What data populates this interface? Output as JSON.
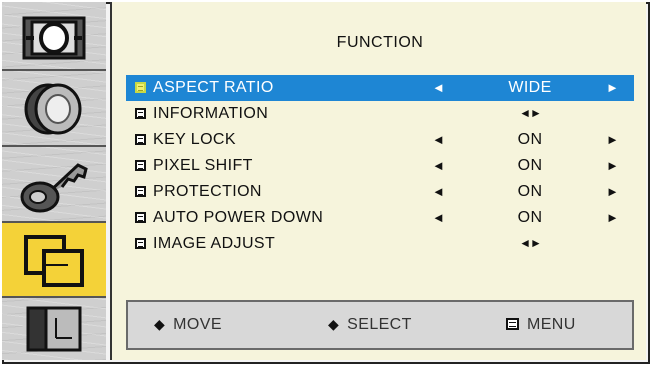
{
  "sidebar": {
    "items": [
      {
        "icon": "picture-icon",
        "active": false
      },
      {
        "icon": "sound-icon",
        "active": false
      },
      {
        "icon": "key-icon",
        "active": false
      },
      {
        "icon": "function-icon",
        "active": true
      },
      {
        "icon": "input-icon",
        "active": false
      }
    ]
  },
  "panel": {
    "title": "FUNCTION",
    "menu": [
      {
        "label": "ASPECT RATIO",
        "left_arrow": "◄",
        "value": "WIDE",
        "right_arrow": "►",
        "selected": true
      },
      {
        "label": "INFORMATION",
        "submenu": "◄►"
      },
      {
        "label": "KEY LOCK",
        "left_arrow": "◄",
        "value": "ON",
        "right_arrow": "►"
      },
      {
        "label": "PIXEL SHIFT",
        "left_arrow": "◄",
        "value": "ON",
        "right_arrow": "►"
      },
      {
        "label": "PROTECTION",
        "left_arrow": "◄",
        "value": "ON",
        "right_arrow": "►"
      },
      {
        "label": "AUTO POWER DOWN",
        "left_arrow": "◄",
        "value": "ON",
        "right_arrow": "►"
      },
      {
        "label": "IMAGE ADJUST",
        "submenu": "◄►"
      }
    ]
  },
  "footer": {
    "move_icon": "◆",
    "move": "MOVE",
    "select_icon": "◆",
    "select": "SELECT",
    "menu": "MENU"
  },
  "colors": {
    "highlight": "#1e86d4",
    "active_tab": "#f4d238",
    "panel_bg": "#f6f4dc"
  }
}
